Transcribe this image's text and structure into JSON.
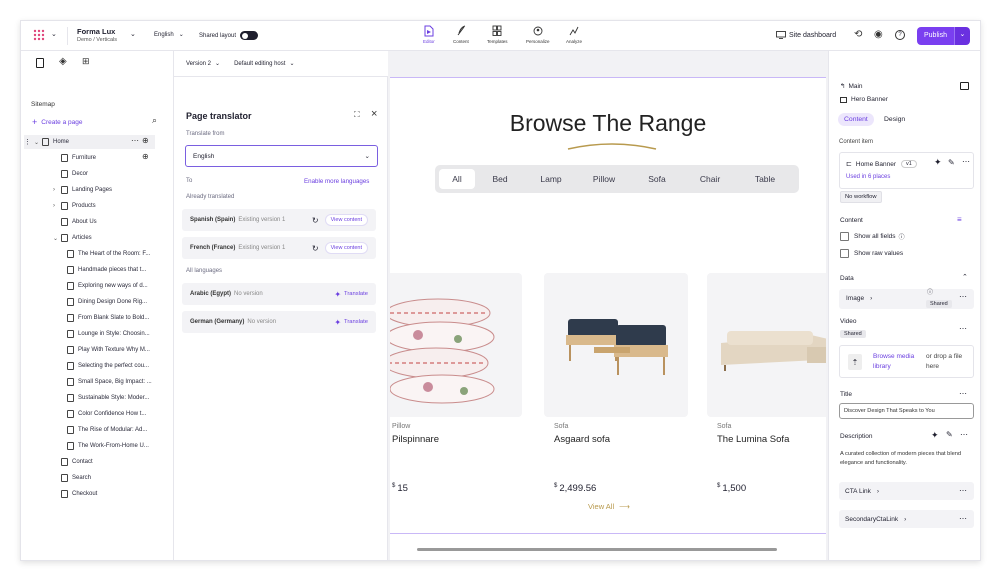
{
  "topbar": {
    "workspace_title": "Forma Lux",
    "workspace_subtitle": "Demo / Verticals",
    "language": "English",
    "shared_layout_label": "Shared layout",
    "tools": [
      {
        "label": "Editor",
        "icon": "editor-icon"
      },
      {
        "label": "Content",
        "icon": "content-icon"
      },
      {
        "label": "Templates",
        "icon": "templates-icon"
      },
      {
        "label": "Personalize",
        "icon": "personalize-icon"
      },
      {
        "label": "Analyze",
        "icon": "analyze-icon"
      }
    ],
    "site_dashboard": "Site dashboard",
    "publish": "Publish"
  },
  "sitemap": {
    "heading": "Sitemap",
    "create_page": "Create a page",
    "items": [
      {
        "label": "Home",
        "level": 0
      },
      {
        "label": "Furniture",
        "level": 1
      },
      {
        "label": "Decor",
        "level": 1
      },
      {
        "label": "Landing Pages",
        "level": 1
      },
      {
        "label": "Products",
        "level": 1
      },
      {
        "label": "About Us",
        "level": 1
      },
      {
        "label": "Articles",
        "level": 1
      },
      {
        "label": "The Heart of the Room: F...",
        "level": 2
      },
      {
        "label": "Handmade pieces that t...",
        "level": 2
      },
      {
        "label": "Exploring new ways of d...",
        "level": 2
      },
      {
        "label": "Dining Design Done Rig...",
        "level": 2
      },
      {
        "label": "From Blank Slate to Bold...",
        "level": 2
      },
      {
        "label": "Lounge in Style: Choosin...",
        "level": 2
      },
      {
        "label": "Play With Texture Why M...",
        "level": 2
      },
      {
        "label": "Selecting the perfect cou...",
        "level": 2
      },
      {
        "label": "Small Space, Big Impact: ...",
        "level": 2
      },
      {
        "label": "Sustainable Style: Moder...",
        "level": 2
      },
      {
        "label": "Color Confidence How t...",
        "level": 2
      },
      {
        "label": "The Rise of Modular: Ad...",
        "level": 2
      },
      {
        "label": "The Work-From-Home U...",
        "level": 2
      },
      {
        "label": "Contact",
        "level": 1
      },
      {
        "label": "Search",
        "level": 1
      },
      {
        "label": "Checkout",
        "level": 1
      }
    ]
  },
  "editor_toolbar": {
    "version": "Version 2",
    "host": "Default editing host"
  },
  "translator": {
    "title": "Page translator",
    "translate_from_label": "Translate from",
    "translate_from_value": "English",
    "to_label": "To",
    "enable_more": "Enable more languages",
    "already_translated_label": "Already translated",
    "translated": [
      {
        "lang": "Spanish (Spain)",
        "status": "Existing version 1",
        "action": "View content"
      },
      {
        "lang": "French (France)",
        "status": "Existing version 1",
        "action": "View content"
      }
    ],
    "all_languages_label": "All languages",
    "untranslated": [
      {
        "lang": "Arabic (Egypt)",
        "status": "No version",
        "action": "Translate"
      },
      {
        "lang": "German (Germany)",
        "status": "No version",
        "action": "Translate"
      }
    ]
  },
  "canvas": {
    "heading": "Browse The Range",
    "filters": [
      "All",
      "Bed",
      "Lamp",
      "Pillow",
      "Sofa",
      "Chair",
      "Table"
    ],
    "products": [
      {
        "category": "Pillow",
        "name": "Pilspinnare",
        "currency": "$",
        "price": "15"
      },
      {
        "category": "Sofa",
        "name": "Asgaard sofa",
        "currency": "$",
        "price": "2,499.56"
      },
      {
        "category": "Sofa",
        "name": "The Lumina Sofa",
        "currency": "$",
        "price": "1,500"
      }
    ],
    "view_all": "View All"
  },
  "rightpanel": {
    "breadcrumb": "Main",
    "component": "Hero Banner",
    "tabs": [
      "Content",
      "Design"
    ],
    "content_item_label": "Content item",
    "item_name": "Home Banner",
    "item_version": "v1",
    "used_in": "Used in 6 places",
    "workflow": "No workflow",
    "content_label": "Content",
    "show_all_fields": "Show all fields",
    "show_raw_values": "Show raw values",
    "data_label": "Data",
    "image_label": "Image",
    "shared_badge": "Shared",
    "video_label": "Video",
    "browse_media": "Browse media library",
    "drop_file": "or drop a file here",
    "title_label": "Title",
    "title_value": "Discover Design That Speaks to You",
    "description_label": "Description",
    "description_value": "A curated collection of modern pieces that blend elegance and functionality.",
    "cta_link": "CTA Link",
    "secondary_cta_link": "SecondaryCtaLink"
  }
}
